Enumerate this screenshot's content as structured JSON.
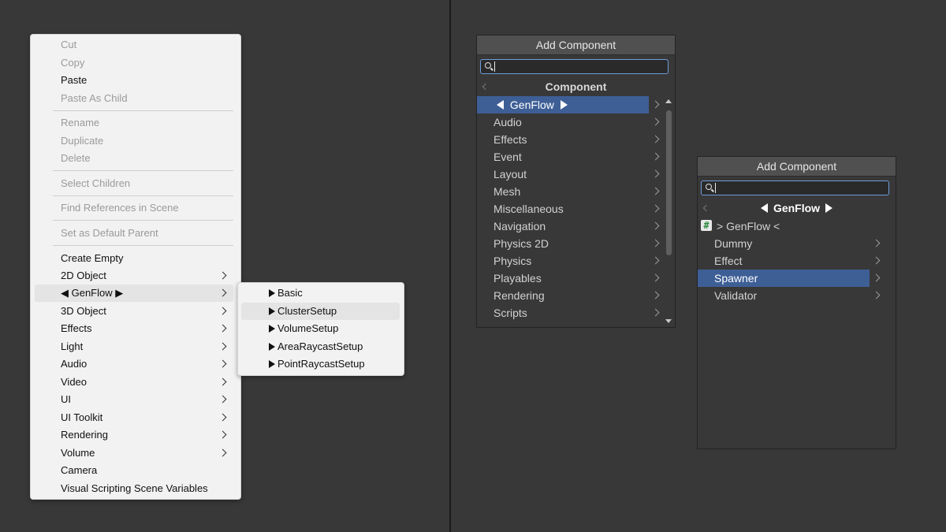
{
  "context_menu": {
    "groups": [
      [
        "Cut",
        "Copy",
        "Paste",
        "Paste As Child"
      ],
      [
        "Rename",
        "Duplicate",
        "Delete"
      ],
      [
        "Select Children"
      ],
      [
        "Find References in Scene"
      ],
      [
        "Set as Default Parent"
      ]
    ],
    "items": {
      "cut": "Cut",
      "copy": "Copy",
      "paste": "Paste",
      "paste_as_child": "Paste As Child",
      "rename": "Rename",
      "duplicate": "Duplicate",
      "delete": "Delete",
      "select_children": "Select Children",
      "find_references": "Find References in Scene",
      "set_default_parent": "Set as Default Parent",
      "create_empty": "Create Empty",
      "object_2d": "2D Object",
      "genflow": "◀ GenFlow ▶",
      "object_3d": "3D Object",
      "effects": "Effects",
      "light": "Light",
      "audio": "Audio",
      "video": "Video",
      "ui": "UI",
      "ui_toolkit": "UI Toolkit",
      "rendering": "Rendering",
      "volume": "Volume",
      "camera": "Camera",
      "visual_scripting": "Visual Scripting Scene Variables"
    }
  },
  "genflow_submenu": {
    "items": [
      "Basic",
      "ClusterSetup",
      "VolumeSetup",
      "AreaRaycastSetup",
      "PointRaycastSetup"
    ],
    "hovered": "ClusterSetup"
  },
  "add_component_1": {
    "title": "Add Component",
    "search_value": "",
    "breadcrumb": "Component",
    "selected": "GenFlow",
    "items": [
      "Audio",
      "Effects",
      "Event",
      "Layout",
      "Mesh",
      "Miscellaneous",
      "Navigation",
      "Physics 2D",
      "Physics",
      "Playables",
      "Rendering",
      "Scripts"
    ]
  },
  "add_component_2": {
    "title": "Add Component",
    "search_value": "",
    "breadcrumb": "GenFlow",
    "script_entry": "> GenFlow <",
    "items": [
      "Dummy",
      "Effect",
      "Spawner",
      "Validator"
    ],
    "selected": "Spawner"
  },
  "colors": {
    "selection_blue": "#3e5f96",
    "search_border": "#6e9ddb",
    "menu_bg": "#f2f2f2",
    "editor_bg": "#383838"
  }
}
